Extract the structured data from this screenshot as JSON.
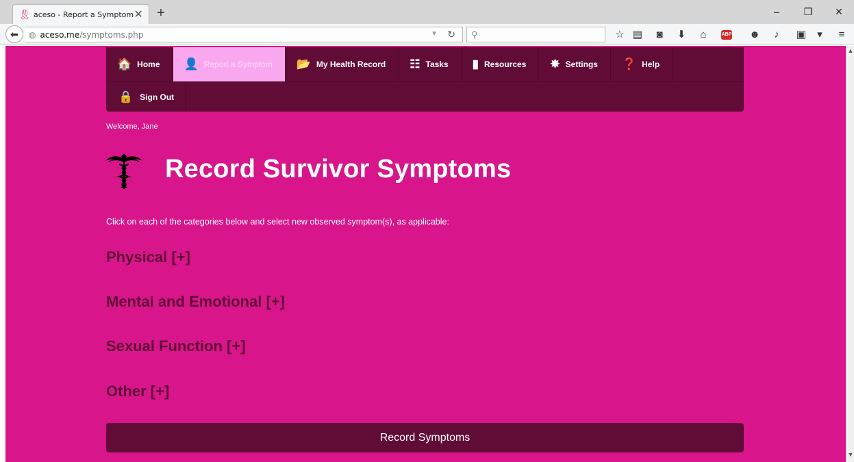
{
  "browser": {
    "tab_title": "aceso - Report a Symptom",
    "tab_close": "✕",
    "new_tab": "+",
    "url_host": "aceso.me",
    "url_path": "/symptoms.php",
    "search_placeholder": "",
    "window_buttons": {
      "minimize": "–",
      "restore": "❐",
      "close": "✕"
    }
  },
  "nav": {
    "row1": [
      {
        "label": "Home",
        "icon": "home-icon",
        "glyph": "🏠"
      },
      {
        "label": "Report a Symptom",
        "icon": "user-icon",
        "glyph": "👤"
      },
      {
        "label": "My Health Record",
        "icon": "folder-icon",
        "glyph": "📂"
      },
      {
        "label": "Tasks",
        "icon": "list-icon",
        "glyph": "☷"
      },
      {
        "label": "Resources",
        "icon": "book-icon",
        "glyph": "▮"
      },
      {
        "label": "Settings",
        "icon": "gear-icon",
        "glyph": "✸"
      },
      {
        "label": "Help",
        "icon": "help-icon",
        "glyph": "❓"
      }
    ],
    "row2": [
      {
        "label": "Sign Out",
        "icon": "lock-icon",
        "glyph": "🔒"
      }
    ],
    "active": "Report a Symptom"
  },
  "welcome": "Welcome, Jane",
  "page_title": "Record Survivor Symptoms",
  "instructions": "Click on each of the categories below and select new observed symptom(s), as applicable:",
  "categories": [
    "Physical [+]",
    "Mental and Emotional [+]",
    "Sexual Function [+]",
    "Other [+]"
  ],
  "record_button": "Record Symptoms",
  "colors": {
    "page_bg": "#d8158a",
    "nav_bg": "#610c36",
    "active_tab": "#f9a8f0",
    "category_text": "#610c36"
  }
}
